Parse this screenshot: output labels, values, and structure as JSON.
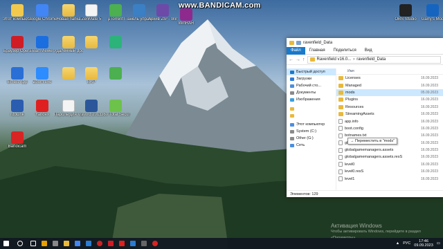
{
  "watermark": "www.BANDICAM.com",
  "desktop_icons": [
    {
      "label": "Этот компьютер",
      "color": "#f2c94c"
    },
    {
      "label": "Google Chrome",
      "color": "#4285f4"
    },
    {
      "label": "Новая папка",
      "color": "#e9b93c"
    },
    {
      "label": "ZenMate 5",
      "color": "#f4f4f4"
    },
    {
      "label": "µTorrent",
      "color": "#4caf50"
    },
    {
      "label": "Панель управления",
      "color": "#3b7fc4"
    },
    {
      "label": "Архив ZIP - WinRAR.zip",
      "color": "#6d4aa8"
    },
    {
      "label": "WinRAR",
      "color": "#8e2a8e"
    },
    {
      "label": "Браузер Opera",
      "color": "#d11c25"
    },
    {
      "label": "TeamViewer",
      "color": "#1a6ee0"
    },
    {
      "label": "Удаленный доступ",
      "color": "#e9b93c"
    },
    {
      "label": "",
      "color": "#e9b93c"
    },
    {
      "label": "",
      "color": "#2bb37a"
    },
    {
      "label": "Emeis App",
      "color": "#2a6fd6"
    },
    {
      "label": "Zoom.exe",
      "color": "#2d8cff"
    },
    {
      "label": "",
      "color": "#e9b93c"
    },
    {
      "label": "BKP",
      "color": "#e9b93c"
    },
    {
      "label": "",
      "color": "#4caf50"
    },
    {
      "label": "rdbLink",
      "color": "#2a5db0"
    },
    {
      "label": "Yandex",
      "color": "#e02020"
    },
    {
      "label": "Пароль для VipClient.txt",
      "color": "#f4f4f4"
    },
    {
      "label": "Word 2013",
      "color": "#2b579a"
    },
    {
      "label": "360 Total Security",
      "color": "#6cc24a"
    },
    {
      "label": "Bandicam",
      "color": "#d92424"
    },
    {
      "label": "OBS Studio",
      "color": "#222222"
    },
    {
      "label": "Garry's Mod",
      "color": "#1565c0"
    }
  ],
  "explorer": {
    "title": "ravenfield_Data",
    "tabs": [
      "Файл",
      "Главная",
      "Поделиться",
      "Вид"
    ],
    "breadcrumb": [
      "Ravenfield v16.0...",
      "ravenfield_Data"
    ],
    "nav_back": "←",
    "nav_forward": "→",
    "nav_up": "↑",
    "sidebar": [
      {
        "label": "Быстрый доступ",
        "color": "#1979ca",
        "selected": true
      },
      {
        "label": "Загрузки",
        "color": "#2f7bd6"
      },
      {
        "label": "Рабочий сто...",
        "color": "#4b8ee0"
      },
      {
        "label": "Документы",
        "color": "#8a8a8a"
      },
      {
        "label": "Изображения",
        "color": "#3a9fe0"
      },
      {
        "label": "",
        "color": "#e9b93c"
      },
      {
        "label": "",
        "color": "#e9b93c"
      },
      {
        "label": "Этот компьютер",
        "color": "#4b8ee0"
      },
      {
        "label": "System (C:)",
        "color": "#8a8a8a"
      },
      {
        "label": "Other (G:)",
        "color": "#8a8a8a"
      },
      {
        "label": "Сеть",
        "color": "#4b8ee0"
      }
    ],
    "column_name": "Имя",
    "rows": [
      {
        "name": "Licenses",
        "type": "folder",
        "date": "16.09.2023"
      },
      {
        "name": "Managed",
        "type": "folder",
        "date": "16.09.2023"
      },
      {
        "name": "mods",
        "type": "folder",
        "date": "05.09.2023"
      },
      {
        "name": "Plugins",
        "type": "folder",
        "date": "16.09.2023"
      },
      {
        "name": "Resources",
        "type": "folder",
        "date": "16.09.2023"
      },
      {
        "name": "StreamingAssets",
        "type": "folder",
        "date": "16.09.2023"
      },
      {
        "name": "app.info",
        "type": "file",
        "date": "16.09.2023"
      },
      {
        "name": "boot.config",
        "type": "file",
        "date": "16.09.2023"
      },
      {
        "name": "botnames.txt",
        "type": "file",
        "date": "16.09.2023"
      },
      {
        "name": "globalgamemanagers",
        "type": "file",
        "date": "16.09.2023"
      },
      {
        "name": "globalgamemanagers.assets",
        "type": "file",
        "date": "16.09.2023"
      },
      {
        "name": "globalgamemanagers.assets.resS",
        "type": "file",
        "date": "16.09.2023"
      },
      {
        "name": "level0",
        "type": "file",
        "date": "16.09.2023"
      },
      {
        "name": "level0.resS",
        "type": "file",
        "date": "16.09.2023"
      },
      {
        "name": "level1",
        "type": "file",
        "date": "16.09.2023"
      }
    ],
    "drag_tooltip": "→ Переместить в \"mods\"",
    "status": "Элементов: 129"
  },
  "activation": {
    "title": "Активация Windows",
    "subtitle": "Чтобы активировать Windows, перейдите в раздел «Параметры»."
  },
  "taskbar": {
    "pinned": [
      {
        "name": "start",
        "color": "#ffffff"
      },
      {
        "name": "search",
        "color": "#ffffff"
      },
      {
        "name": "task-view",
        "color": "#ffffff"
      },
      {
        "name": "app-1",
        "color": "#e8a000"
      },
      {
        "name": "app-2",
        "color": "#888888"
      },
      {
        "name": "explorer",
        "color": "#e9b93c"
      },
      {
        "name": "chrome",
        "color": "#4285f4"
      },
      {
        "name": "store",
        "color": "#2b7cd3"
      },
      {
        "name": "app-3",
        "color": "#cc2222"
      },
      {
        "name": "app-4",
        "color": "#d11c25"
      },
      {
        "name": "yandex",
        "color": "#e02020"
      },
      {
        "name": "mail",
        "color": "#2b7cd3"
      },
      {
        "name": "app-5",
        "color": "#666666"
      },
      {
        "name": "bandicam",
        "color": "#d92424"
      }
    ],
    "lang": "РУС",
    "time": "17:46",
    "date": "09.09.2023"
  }
}
